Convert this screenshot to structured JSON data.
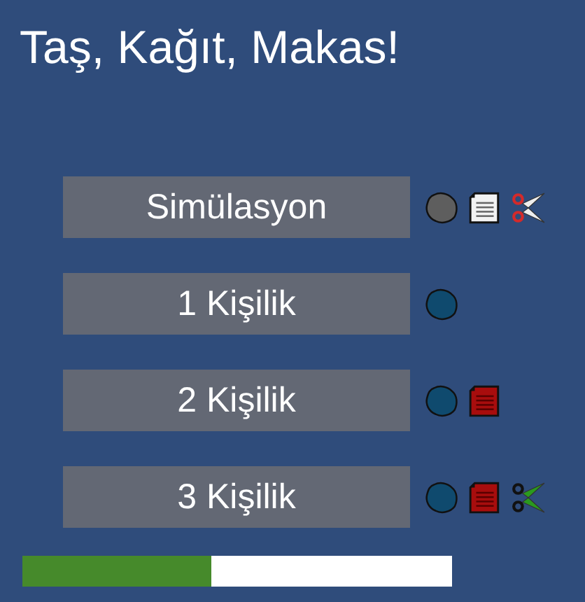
{
  "title": "Taş, Kağıt, Makas!",
  "modes": [
    {
      "label": "Simülasyon",
      "icons": [
        {
          "kind": "rock",
          "color": "#5e5e5e"
        },
        {
          "kind": "paper",
          "color": "#f2f2f2"
        },
        {
          "kind": "scissors",
          "color": "#d42a2a"
        }
      ]
    },
    {
      "label": "1 Kişilik",
      "icons": [
        {
          "kind": "rock",
          "color": "#0f4a6e"
        }
      ]
    },
    {
      "label": "2 Kişilik",
      "icons": [
        {
          "kind": "rock",
          "color": "#0f4a6e"
        },
        {
          "kind": "paper",
          "color": "#a80d0d"
        }
      ]
    },
    {
      "label": "3 Kişilik",
      "icons": [
        {
          "kind": "rock",
          "color": "#0f4a6e"
        },
        {
          "kind": "paper",
          "color": "#a80d0d"
        },
        {
          "kind": "scissors",
          "color": "#2a9a1e"
        }
      ]
    }
  ],
  "progress": {
    "level": 0.44
  }
}
